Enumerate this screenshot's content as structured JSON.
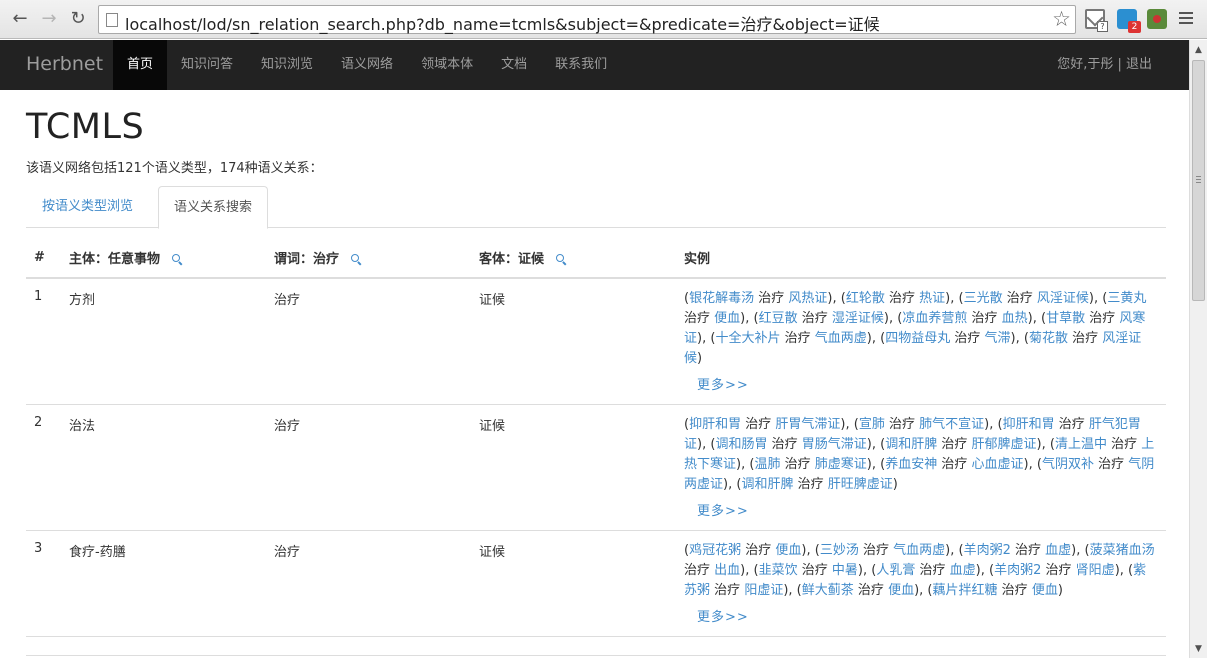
{
  "browser": {
    "url": "localhost/lod/sn_relation_search.php?db_name=tcmls&subject=&predicate=治疗&object=证候",
    "back_glyph": "←",
    "forward_glyph": "→",
    "reload_glyph": "↻",
    "star_glyph": "☆",
    "extension_badge": "2",
    "gmail_badge": "?"
  },
  "navbar": {
    "brand": "Herbnet",
    "items": [
      "首页",
      "知识问答",
      "知识浏览",
      "语义网络",
      "领域本体",
      "文档",
      "联系我们"
    ],
    "active_index": 0,
    "user": "您好,于彤 | 退出"
  },
  "page": {
    "title": "TCMLS",
    "summary": "该语义网络包括121个语义类型，174种语义关系："
  },
  "tabs": [
    "按语义类型浏览",
    "语义关系搜索"
  ],
  "table": {
    "headers": {
      "num": "#",
      "subject": "主体：任意事物",
      "predicate": "谓词：治疗",
      "object": "客体：证候",
      "examples": "实例"
    },
    "more_label": "更多>>",
    "rows": [
      {
        "num": "1",
        "subject": "方剂",
        "predicate": "治疗",
        "object": "证候",
        "examples": [
          {
            "s": "银花解毒汤",
            "p": "治疗",
            "o": "风热证"
          },
          {
            "s": "红轮散",
            "p": "治疗",
            "o": "热证"
          },
          {
            "s": "三光散",
            "p": "治疗",
            "o": "风淫证候"
          },
          {
            "s": "三黄丸",
            "p": "治疗",
            "o": "便血"
          },
          {
            "s": "红豆散",
            "p": "治疗",
            "o": "湿淫证候"
          },
          {
            "s": "凉血养营煎",
            "p": "治疗",
            "o": "血热"
          },
          {
            "s": "甘草散",
            "p": "治疗",
            "o": "风寒证"
          },
          {
            "s": "十全大补片",
            "p": "治疗",
            "o": "气血两虚"
          },
          {
            "s": "四物益母丸",
            "p": "治疗",
            "o": "气滞"
          },
          {
            "s": "菊花散",
            "p": "治疗",
            "o": "风淫证候"
          }
        ]
      },
      {
        "num": "2",
        "subject": "治法",
        "predicate": "治疗",
        "object": "证候",
        "examples": [
          {
            "s": "抑肝和胃",
            "p": "治疗",
            "o": "肝胃气滞证"
          },
          {
            "s": "宣肺",
            "p": "治疗",
            "o": "肺气不宣证"
          },
          {
            "s": "抑肝和胃",
            "p": "治疗",
            "o": "肝气犯胃证"
          },
          {
            "s": "调和肠胃",
            "p": "治疗",
            "o": "胃肠气滞证"
          },
          {
            "s": "调和肝脾",
            "p": "治疗",
            "o": "肝郁脾虚证"
          },
          {
            "s": "清上温中",
            "p": "治疗",
            "o": "上热下寒证"
          },
          {
            "s": "温肺",
            "p": "治疗",
            "o": "肺虚寒证"
          },
          {
            "s": "养血安神",
            "p": "治疗",
            "o": "心血虚证"
          },
          {
            "s": "气阴双补",
            "p": "治疗",
            "o": "气阴两虚证"
          },
          {
            "s": "调和肝脾",
            "p": "治疗",
            "o": "肝旺脾虚证"
          }
        ]
      },
      {
        "num": "3",
        "subject": "食疗-药膳",
        "predicate": "治疗",
        "object": "证候",
        "examples": [
          {
            "s": "鸡冠花粥",
            "p": "治疗",
            "o": "便血"
          },
          {
            "s": "三妙汤",
            "p": "治疗",
            "o": "气血两虚"
          },
          {
            "s": "羊肉粥2",
            "p": "治疗",
            "o": "血虚"
          },
          {
            "s": "菠菜猪血汤",
            "p": "治疗",
            "o": "出血"
          },
          {
            "s": "韭菜饮",
            "p": "治疗",
            "o": "中暑"
          },
          {
            "s": "人乳膏",
            "p": "治疗",
            "o": "血虚"
          },
          {
            "s": "羊肉粥2",
            "p": "治疗",
            "o": "肾阳虚"
          },
          {
            "s": "紫苏粥",
            "p": "治疗",
            "o": "阳虚证"
          },
          {
            "s": "鲜大蓟茶",
            "p": "治疗",
            "o": "便血"
          },
          {
            "s": "藕片拌红糖",
            "p": "治疗",
            "o": "便血"
          }
        ]
      }
    ]
  },
  "scrollbar": {
    "up_glyph": "▲",
    "down_glyph": "▼"
  }
}
